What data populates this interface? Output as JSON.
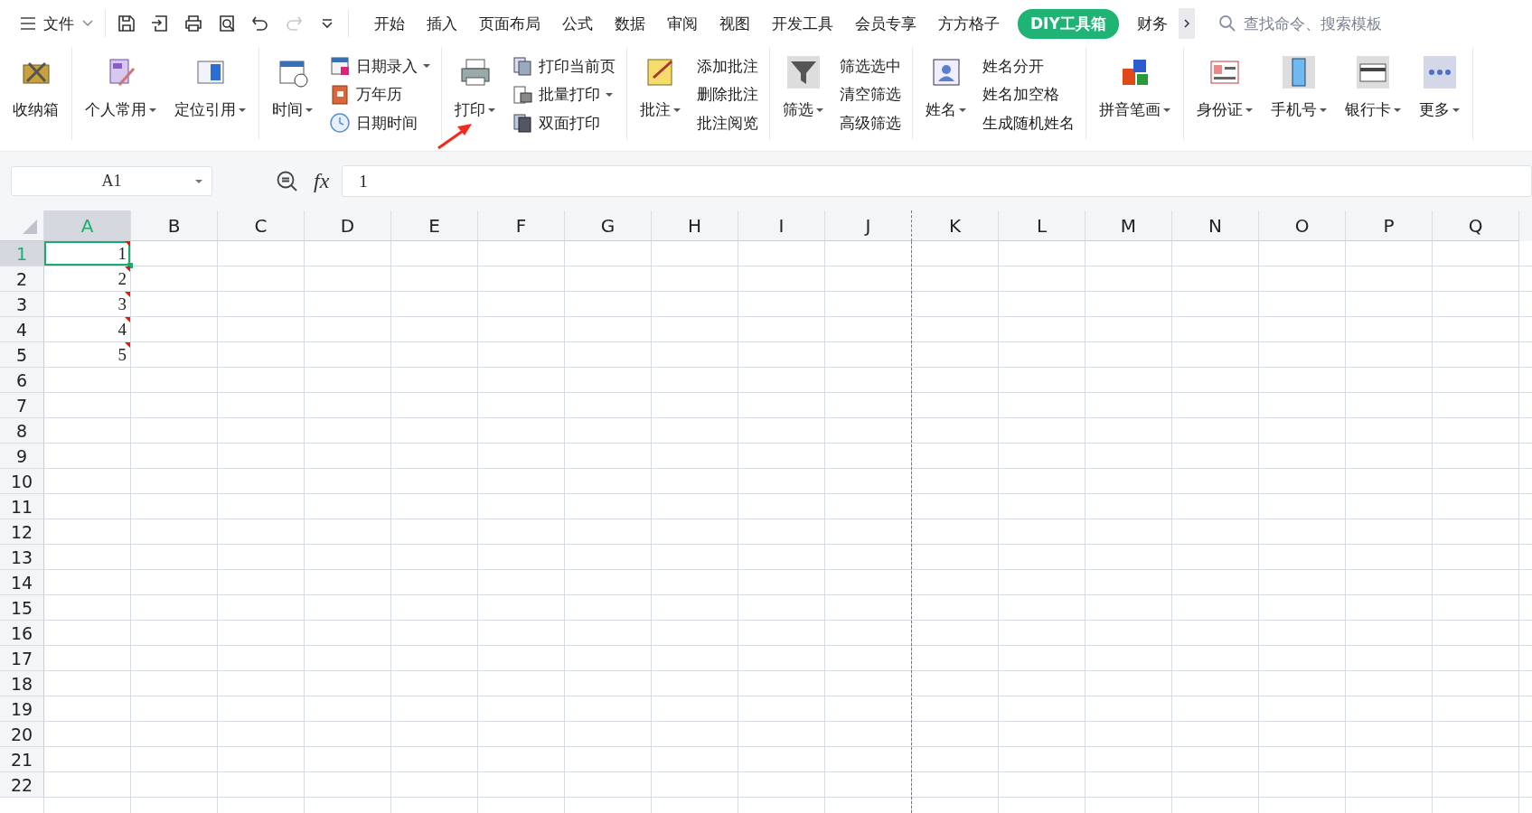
{
  "menu_bar": {
    "file_menu": "文件",
    "quick_access": [
      {
        "disabled": false
      },
      {
        "disabled": false
      },
      {
        "disabled": false
      },
      {
        "disabled": false
      },
      {
        "disabled": false
      },
      {
        "disabled": true
      },
      {
        "disabled": false
      }
    ],
    "tabs": [
      {
        "label": "开始",
        "selected": false
      },
      {
        "label": "插入",
        "selected": false
      },
      {
        "label": "页面布局",
        "selected": false
      },
      {
        "label": "公式",
        "selected": false
      },
      {
        "label": "数据",
        "selected": false
      },
      {
        "label": "审阅",
        "selected": false
      },
      {
        "label": "视图",
        "selected": false
      },
      {
        "label": "开发工具",
        "selected": false
      },
      {
        "label": "会员专享",
        "selected": false
      },
      {
        "label": "方方格子",
        "selected": false
      },
      {
        "label": "DIY工具箱",
        "selected": true
      },
      {
        "label": "财务",
        "selected": false
      }
    ],
    "search": {
      "placeholder": "查找命令、搜索模板"
    }
  },
  "ribbon": {
    "groups": [
      {
        "entries": [
          {
            "kind": "large",
            "label": "收纳箱",
            "dropdown": false
          }
        ]
      },
      {
        "entries": [
          {
            "kind": "large",
            "label": "个人常用",
            "dropdown": true
          },
          {
            "kind": "large",
            "label": "定位引用",
            "dropdown": true
          }
        ]
      },
      {
        "entries": [
          {
            "kind": "large",
            "label": "时间",
            "dropdown": true
          },
          {
            "kind": "column",
            "items": [
              {
                "label": "日期录入",
                "icon": true,
                "dropdown": true
              },
              {
                "label": "万年历",
                "icon": true,
                "dropdown": false
              },
              {
                "label": "日期时间",
                "icon": true,
                "dropdown": false
              }
            ]
          }
        ]
      },
      {
        "entries": [
          {
            "kind": "large",
            "label": "打印",
            "dropdown": true
          },
          {
            "kind": "column",
            "items": [
              {
                "label": "打印当前页",
                "icon": true,
                "dropdown": false
              },
              {
                "label": "批量打印",
                "icon": true,
                "dropdown": true
              },
              {
                "label": "双面打印",
                "icon": true,
                "dropdown": false
              }
            ]
          }
        ]
      },
      {
        "entries": [
          {
            "kind": "large",
            "label": "批注",
            "dropdown": true
          },
          {
            "kind": "column",
            "items": [
              {
                "label": "添加批注",
                "icon": false,
                "dropdown": false
              },
              {
                "label": "删除批注",
                "icon": false,
                "dropdown": false
              },
              {
                "label": "批注阅览",
                "icon": false,
                "dropdown": false
              }
            ]
          }
        ]
      },
      {
        "entries": [
          {
            "kind": "large",
            "label": "筛选",
            "dropdown": true
          },
          {
            "kind": "column",
            "items": [
              {
                "label": "筛选选中",
                "icon": false,
                "dropdown": false
              },
              {
                "label": "清空筛选",
                "icon": false,
                "dropdown": false
              },
              {
                "label": "高级筛选",
                "icon": false,
                "dropdown": false
              }
            ]
          }
        ]
      },
      {
        "entries": [
          {
            "kind": "large",
            "label": "姓名",
            "dropdown": true
          },
          {
            "kind": "column",
            "items": [
              {
                "label": "姓名分开",
                "icon": false,
                "dropdown": false
              },
              {
                "label": "姓名加空格",
                "icon": false,
                "dropdown": false
              },
              {
                "label": "生成随机姓名",
                "icon": false,
                "dropdown": false
              }
            ]
          }
        ]
      },
      {
        "entries": [
          {
            "kind": "large",
            "label": "拼音笔画",
            "dropdown": true
          }
        ]
      },
      {
        "entries": [
          {
            "kind": "large",
            "label": "身份证",
            "dropdown": true
          },
          {
            "kind": "large",
            "label": "手机号",
            "dropdown": true
          },
          {
            "kind": "large",
            "label": "银行卡",
            "dropdown": true
          },
          {
            "kind": "large",
            "label": "更多",
            "dropdown": true
          }
        ]
      }
    ]
  },
  "formula_bar": {
    "name_box": "A1",
    "fx_label": "fx",
    "formula": "1"
  },
  "sheet": {
    "columns": [
      {
        "label": "A",
        "selected": true,
        "page_break": false
      },
      {
        "label": "B",
        "selected": false,
        "page_break": false
      },
      {
        "label": "C",
        "selected": false,
        "page_break": false
      },
      {
        "label": "D",
        "selected": false,
        "page_break": false
      },
      {
        "label": "E",
        "selected": false,
        "page_break": false
      },
      {
        "label": "F",
        "selected": false,
        "page_break": false
      },
      {
        "label": "G",
        "selected": false,
        "page_break": false
      },
      {
        "label": "H",
        "selected": false,
        "page_break": false
      },
      {
        "label": "I",
        "selected": false,
        "page_break": false
      },
      {
        "label": "J",
        "selected": false,
        "page_break": true
      },
      {
        "label": "K",
        "selected": false,
        "page_break": false
      },
      {
        "label": "L",
        "selected": false,
        "page_break": false
      },
      {
        "label": "M",
        "selected": false,
        "page_break": false
      },
      {
        "label": "N",
        "selected": false,
        "page_break": false
      },
      {
        "label": "O",
        "selected": false,
        "page_break": false
      },
      {
        "label": "P",
        "selected": false,
        "page_break": false
      },
      {
        "label": "Q",
        "selected": false,
        "page_break": false
      }
    ],
    "rows": [
      {
        "header": "1",
        "selected": true,
        "cells": [
          {
            "value": "1",
            "comment": true,
            "active": true
          }
        ]
      },
      {
        "header": "2",
        "selected": false,
        "cells": [
          {
            "value": "2",
            "comment": true,
            "active": false
          }
        ]
      },
      {
        "header": "3",
        "selected": false,
        "cells": [
          {
            "value": "3",
            "comment": true,
            "active": false
          }
        ]
      },
      {
        "header": "4",
        "selected": false,
        "cells": [
          {
            "value": "4",
            "comment": true,
            "active": false
          }
        ]
      },
      {
        "header": "5",
        "selected": false,
        "cells": [
          {
            "value": "5",
            "comment": true,
            "active": false
          }
        ]
      },
      {
        "header": "6",
        "selected": false
      },
      {
        "header": "7",
        "selected": false
      },
      {
        "header": "8",
        "selected": false
      },
      {
        "header": "9",
        "selected": false
      },
      {
        "header": "10",
        "selected": false
      },
      {
        "header": "11",
        "selected": false
      },
      {
        "header": "12",
        "selected": false
      },
      {
        "header": "13",
        "selected": false
      },
      {
        "header": "14",
        "selected": false
      },
      {
        "header": "15",
        "selected": false
      },
      {
        "header": "16",
        "selected": false
      },
      {
        "header": "17",
        "selected": false
      },
      {
        "header": "18",
        "selected": false
      },
      {
        "header": "19",
        "selected": false
      },
      {
        "header": "20",
        "selected": false
      },
      {
        "header": "21",
        "selected": false
      },
      {
        "header": "22",
        "selected": false
      }
    ]
  }
}
